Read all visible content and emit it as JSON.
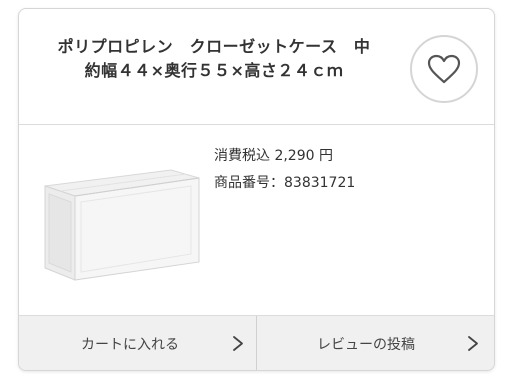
{
  "product": {
    "title_line1": "ポリプロピレン　クローゼットケース　中",
    "title_line2": "約幅４４×奥行５５×高さ２４ｃｍ",
    "price_text": "消費税込 2,290 円",
    "code_text": "商品番号：83831721"
  },
  "favorite": {
    "icon": "heart-outline-icon"
  },
  "actions": {
    "cart_label": "カートに入れる",
    "review_label": "レビューの投稿",
    "chevron_icon": "chevron-right-icon"
  }
}
